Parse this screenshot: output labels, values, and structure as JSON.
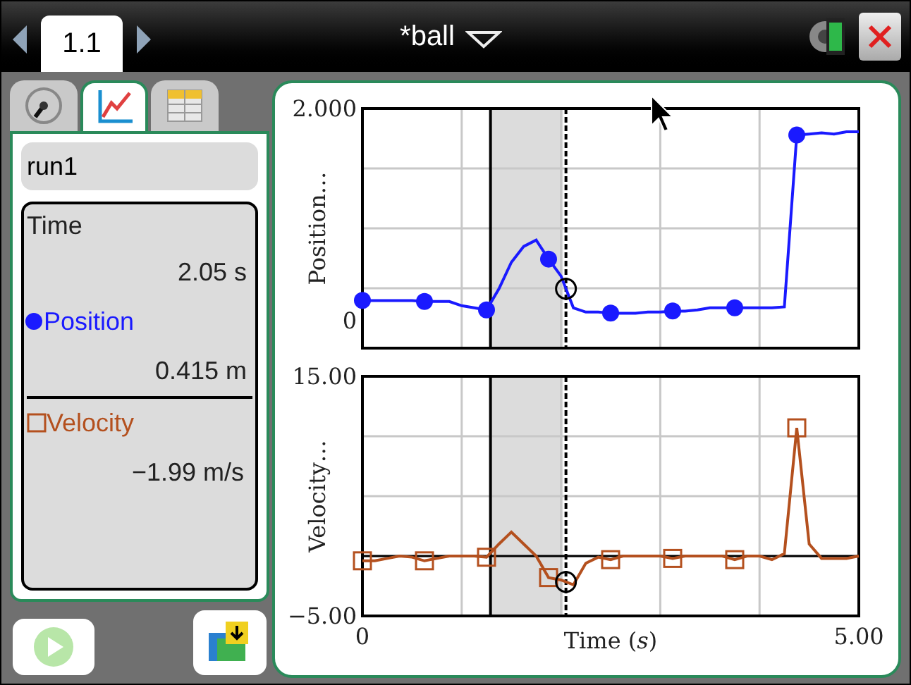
{
  "header": {
    "tabs": [
      {
        "label": "1.1",
        "selected": true
      }
    ],
    "title": "*ball"
  },
  "side_tabs": [
    {
      "kind": "meter",
      "selected": false
    },
    {
      "kind": "graph",
      "selected": true
    },
    {
      "kind": "table",
      "selected": false
    }
  ],
  "run": "run1",
  "readout": {
    "time_label": "Time",
    "time_value": "2.05 s",
    "sensors": [
      {
        "name": "Position",
        "kind": "dot",
        "color": "#1a1aff",
        "value": "0.415 m"
      },
      {
        "name": "Velocity",
        "kind": "square",
        "color": "#b4501e",
        "value": "−1.99 m/s"
      }
    ]
  },
  "play_button": {
    "disabled": true
  },
  "charts": [
    {
      "chart_data": {
        "type": "line",
        "ylabel": "Position…",
        "xlim": [
          0,
          5
        ],
        "ylim": [
          -0.26,
          2
        ],
        "yticks": [
          {
            "value": 0,
            "label": "0"
          },
          {
            "value": 2,
            "label": "2.000"
          }
        ],
        "bands": [
          {
            "axis": "x",
            "from": 1.29,
            "to": 2.02
          }
        ],
        "ref_lines": [
          {
            "axis": "x",
            "value": 1.29
          },
          {
            "axis": "x",
            "value": 2.05
          }
        ],
        "x": [
          0,
          0.125,
          0.25,
          0.375,
          0.5,
          0.625,
          0.75,
          0.875,
          1,
          1.125,
          1.25,
          1.375,
          1.5,
          1.625,
          1.75,
          1.875,
          2,
          2.125,
          2.25,
          2.375,
          2.5,
          2.625,
          2.75,
          2.875,
          3,
          3.125,
          3.25,
          3.375,
          3.5,
          3.625,
          3.75,
          3.875,
          4,
          4.125,
          4.25,
          4.375,
          4.5,
          4.625,
          4.75,
          4.875,
          5
        ],
        "series": [
          {
            "color": "#1a1aff",
            "values": [
              0.19,
              0.19,
              0.19,
              0.19,
              0.19,
              0.18,
              0.18,
              0.18,
              0.14,
              0.12,
              0.1,
              0.3,
              0.55,
              0.7,
              0.76,
              0.58,
              0.42,
              0.12,
              0.08,
              0.08,
              0.07,
              0.07,
              0.07,
              0.08,
              0.08,
              0.09,
              0.09,
              0.1,
              0.12,
              0.12,
              0.12,
              0.12,
              0.12,
              0.12,
              0.13,
              1.75,
              1.76,
              1.77,
              1.76,
              1.78,
              1.78
            ]
          }
        ]
      }
    },
    {
      "chart_data": {
        "type": "line",
        "ylabel": "Velocity…",
        "xlabel": "Time (*s*)",
        "xlim": [
          0,
          5
        ],
        "ylim": [
          -5,
          15
        ],
        "xticks": [
          {
            "value": 0,
            "label": "0"
          },
          {
            "value": 5,
            "label": "5.00"
          }
        ],
        "yticks": [
          {
            "value": 15,
            "label": "15.00"
          },
          {
            "value": -5,
            "label": "−5.00"
          }
        ],
        "bands": [
          {
            "axis": "x",
            "from": 1.29,
            "to": 2.02
          }
        ],
        "ref_lines": [
          {
            "axis": "y",
            "value": 0
          },
          {
            "axis": "x",
            "value": 1.29
          },
          {
            "axis": "x",
            "value": 2.05
          }
        ],
        "x": [
          0,
          0.125,
          0.25,
          0.375,
          0.5,
          0.625,
          0.75,
          0.875,
          1,
          1.125,
          1.25,
          1.375,
          1.5,
          1.625,
          1.75,
          1.875,
          2,
          2.125,
          2.25,
          2.375,
          2.5,
          2.625,
          2.75,
          2.875,
          3,
          3.125,
          3.25,
          3.375,
          3.5,
          3.625,
          3.75,
          3.875,
          4,
          4.125,
          4.25,
          4.375,
          4.5,
          4.625,
          4.75,
          4.875,
          5
        ],
        "series": [
          {
            "color": "#b4501e",
            "values": [
              -0.4,
              -0.4,
              -0.2,
              0,
              -0.1,
              -0.4,
              -0.2,
              0,
              0,
              0,
              -0.1,
              1,
              2,
              1,
              0,
              -1.8,
              -2,
              -2.4,
              -0.6,
              -0.1,
              -0.3,
              0,
              0,
              0,
              0,
              -0.2,
              0,
              0,
              0,
              0,
              -0.3,
              0,
              0,
              -0.3,
              0.2,
              10.7,
              1,
              -0.2,
              -0.2,
              -0.2,
              0
            ]
          }
        ]
      }
    }
  ]
}
